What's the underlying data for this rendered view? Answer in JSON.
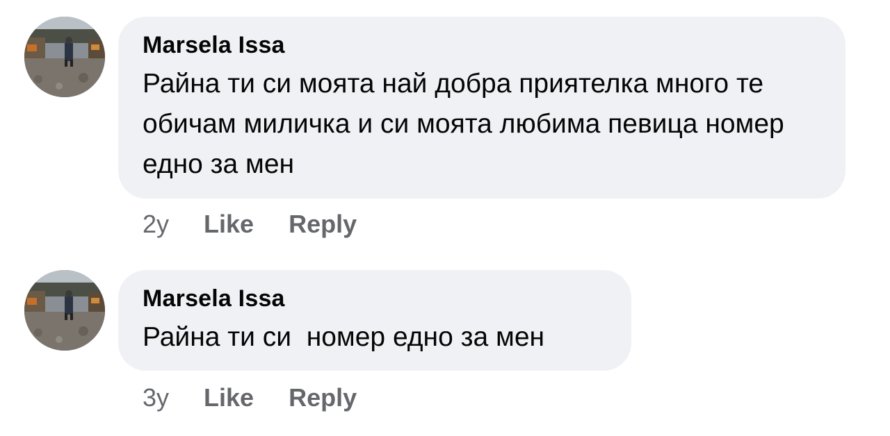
{
  "comments": [
    {
      "author": "Marsela Issa",
      "text": "Райна ти си моята най добра приятелка много те обичам миличка и си моята любима певица номер едно за мен",
      "time": "2y",
      "like_label": "Like",
      "reply_label": "Reply"
    },
    {
      "author": "Marsela Issa",
      "text": "Райна ти си  номер едно за мен",
      "time": "3y",
      "like_label": "Like",
      "reply_label": "Reply"
    }
  ],
  "colors": {
    "bubble_background": "#f0f1f5",
    "action_text": "#65676b",
    "primary_text": "#050505"
  }
}
